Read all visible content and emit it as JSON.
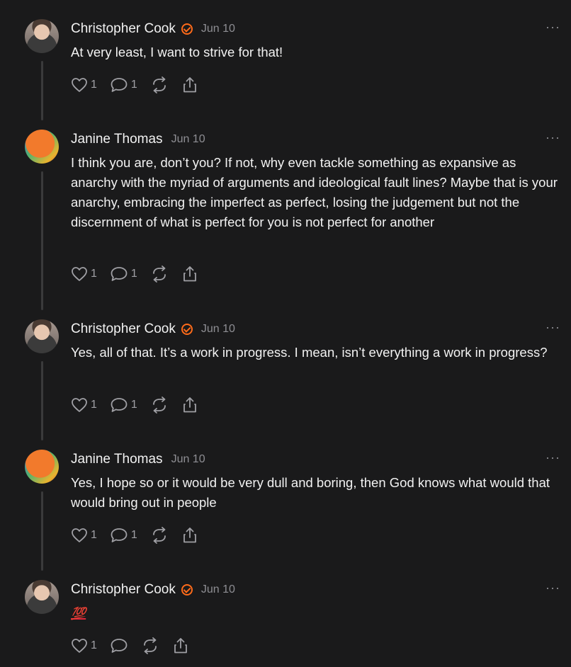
{
  "comments": [
    {
      "author": "Christopher Cook",
      "verified": true,
      "date": "Jun 10",
      "text": "At very least, I want to strive for that!",
      "likes": "1",
      "replies": "1"
    },
    {
      "author": "Janine Thomas",
      "verified": false,
      "date": "Jun 10",
      "text": "I think you are, don’t you? If not, why even tackle something as expansive as anarchy with the myriad of arguments and ideological fault lines? Maybe that is your anarchy, embracing the imperfect as perfect, losing the judgement but not the discernment of what is perfect for you is not perfect for another",
      "likes": "1",
      "replies": "1"
    },
    {
      "author": "Christopher Cook",
      "verified": true,
      "date": "Jun 10",
      "text": "Yes, all of that. It’s a work in progress. I mean, isn’t everything a work in progress?",
      "likes": "1",
      "replies": "1"
    },
    {
      "author": "Janine Thomas",
      "verified": false,
      "date": "Jun 10",
      "text": "Yes, I hope so or it would be very dull and boring, then God knows what would that would bring out in people",
      "likes": "1",
      "replies": "1"
    },
    {
      "author": "Christopher Cook",
      "verified": true,
      "date": "Jun 10",
      "text": "💯",
      "likes": "1",
      "replies": ""
    }
  ],
  "ui": {
    "more_glyph": "···",
    "accent_color": "#ff6b1a",
    "icons": [
      "heart-icon",
      "comment-icon",
      "restack-icon",
      "share-icon",
      "more-icon",
      "verified-icon"
    ]
  }
}
